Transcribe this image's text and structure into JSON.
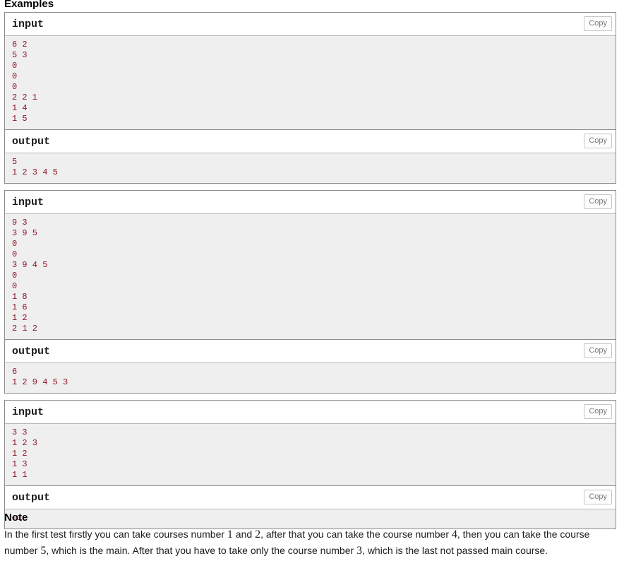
{
  "examples": {
    "heading": "Examples",
    "copy_label": "Copy",
    "input_label": "input",
    "output_label": "output",
    "tests": [
      {
        "input": "6 2\n5 3\n0\n0\n0\n2 2 1\n1 4\n1 5",
        "output": "5\n1 2 3 4 5"
      },
      {
        "input": "9 3\n3 9 5\n0\n0\n3 9 4 5\n0\n0\n1 8\n1 6\n1 2\n2 1 2",
        "output": "6\n1 2 9 4 5 3"
      },
      {
        "input": "3 3\n1 2 3\n1 2\n1 3\n1 1",
        "output": "-1"
      }
    ]
  },
  "note": {
    "heading": "Note",
    "parts": [
      {
        "type": "text",
        "value": "In the first test firstly you can take courses number "
      },
      {
        "type": "math",
        "value": "1"
      },
      {
        "type": "text",
        "value": " and "
      },
      {
        "type": "math",
        "value": "2"
      },
      {
        "type": "text",
        "value": ", after that you can take the course number "
      },
      {
        "type": "math",
        "value": "4"
      },
      {
        "type": "text",
        "value": ", then you can take the course number "
      },
      {
        "type": "math",
        "value": "5"
      },
      {
        "type": "text",
        "value": ", which is the main. After that you have to take only the course number "
      },
      {
        "type": "math",
        "value": "3"
      },
      {
        "type": "text",
        "value": ", which is the last not passed main course."
      }
    ],
    "plain": "In the first test firstly you can take courses number 1 and 2, after that you can take the course number 4, then you can take the course number 5, which is the main. After that you have to take only the course number 3, which is the last not passed main course."
  },
  "colors": {
    "data_text": "#8f1725",
    "pre_background": "#efeff0",
    "border": "#8d8d8d",
    "copy_text": "#7a7a7a"
  }
}
